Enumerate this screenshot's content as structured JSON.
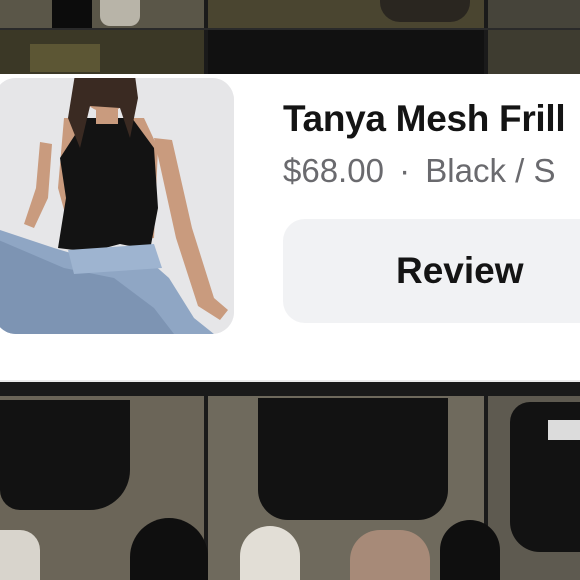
{
  "product": {
    "title": "Tanya Mesh Frill",
    "price": "$68.00",
    "separator": "·",
    "variant": "Black / S",
    "image_icon": "product-photo"
  },
  "actions": {
    "review_label": "Review"
  },
  "colors": {
    "card_background": "#ffffff",
    "button_background": "#f1f2f4",
    "title_color": "#141414",
    "meta_color": "#6a6a6e"
  }
}
